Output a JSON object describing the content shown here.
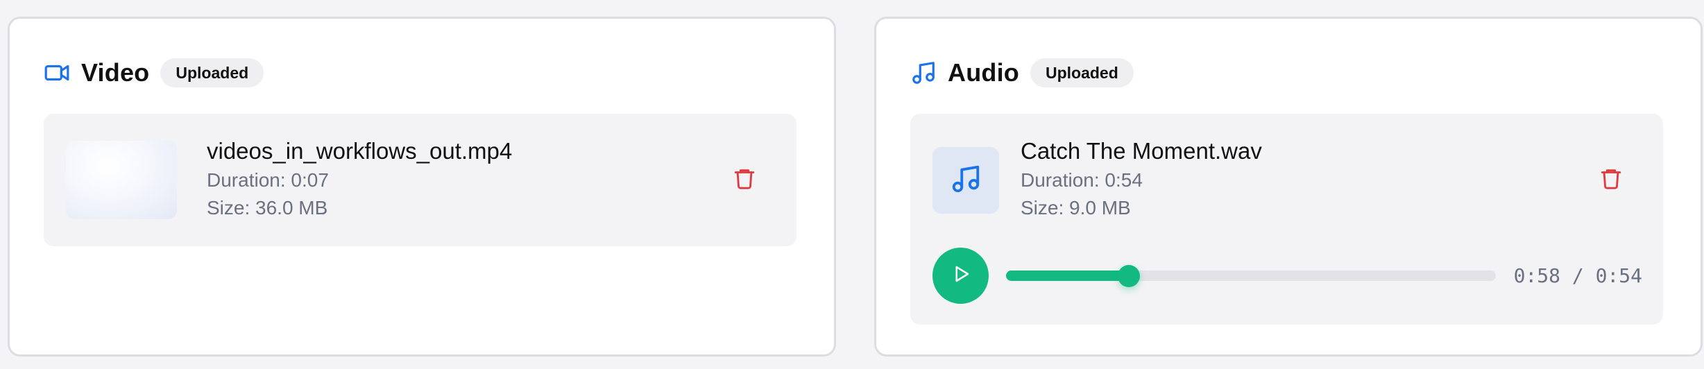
{
  "colors": {
    "accent_blue": "#1a73e8",
    "play_green": "#12b981",
    "delete_red": "#e0393e",
    "meta_gray": "#6b7080"
  },
  "video": {
    "title": "Video",
    "title_icon": "video-camera-icon",
    "status": "Uploaded",
    "file": {
      "name": "videos_in_workflows_out.mp4",
      "duration": "Duration: 0:07",
      "size": "Size: 36.0 MB"
    },
    "delete_icon": "trash-icon"
  },
  "audio": {
    "title": "Audio",
    "title_icon": "music-note-icon",
    "status": "Uploaded",
    "file": {
      "name": "Catch The Moment.wav",
      "duration": "Duration: 0:54",
      "size": "Size: 9.0 MB"
    },
    "delete_icon": "trash-icon",
    "player": {
      "play_icon": "play-icon",
      "progress_fraction": 0.25,
      "time": "0:58 / 0:54"
    }
  }
}
